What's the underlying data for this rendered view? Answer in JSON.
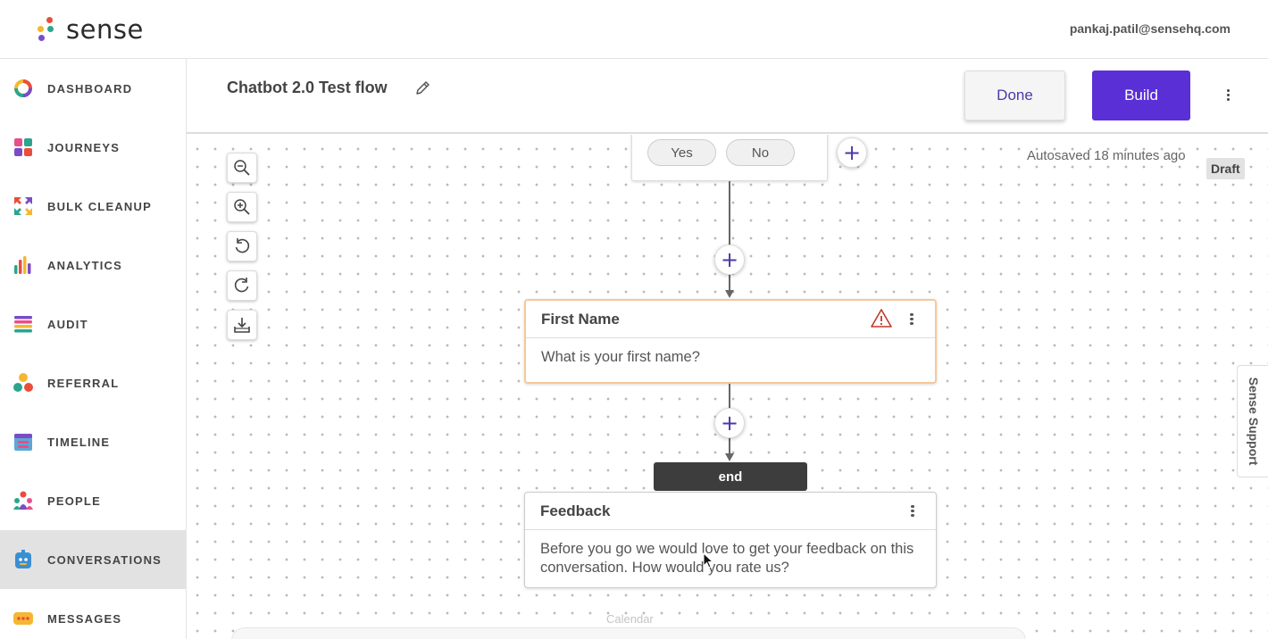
{
  "app": {
    "logo_text": "sense",
    "user_email": "pankaj.patil@sensehq.com"
  },
  "sidebar": {
    "items": [
      {
        "label": "DASHBOARD",
        "icon": "dashboard-icon",
        "active": false
      },
      {
        "label": "JOURNEYS",
        "icon": "journeys-icon",
        "active": false
      },
      {
        "label": "BULK CLEANUP",
        "icon": "bulk-cleanup-icon",
        "active": false
      },
      {
        "label": "ANALYTICS",
        "icon": "analytics-icon",
        "active": false
      },
      {
        "label": "AUDIT",
        "icon": "audit-icon",
        "active": false
      },
      {
        "label": "REFERRAL",
        "icon": "referral-icon",
        "active": false
      },
      {
        "label": "TIMELINE",
        "icon": "timeline-icon",
        "active": false
      },
      {
        "label": "PEOPLE",
        "icon": "people-icon",
        "active": false
      },
      {
        "label": "CONVERSATIONS",
        "icon": "conversations-icon",
        "active": true
      },
      {
        "label": "MESSAGES",
        "icon": "messages-icon",
        "active": false
      }
    ]
  },
  "header": {
    "flow_title": "Chatbot 2.0 Test flow",
    "done_label": "Done",
    "build_label": "Build"
  },
  "canvas": {
    "autosaved": "Autosaved 18 minutes ago",
    "status_badge": "Draft",
    "support_tab": "Sense Support",
    "prev_node": {
      "options": [
        "Yes",
        "No"
      ]
    },
    "nodes": [
      {
        "title": "First Name",
        "body": "What is your first name?",
        "warning": true
      },
      {
        "title": "Feedback",
        "body": "Before you go we would love to get your feedback on this conversation. How would you rate us?",
        "warning": false
      }
    ],
    "end_label": "end",
    "calendar_label": "Calendar"
  },
  "colors": {
    "accent": "#5a2fd6",
    "accent_text": "#4a3aa8",
    "active_nav_bg": "#e2e2e2",
    "warning_border": "#f5c89a",
    "warning_icon": "#c0392b"
  }
}
